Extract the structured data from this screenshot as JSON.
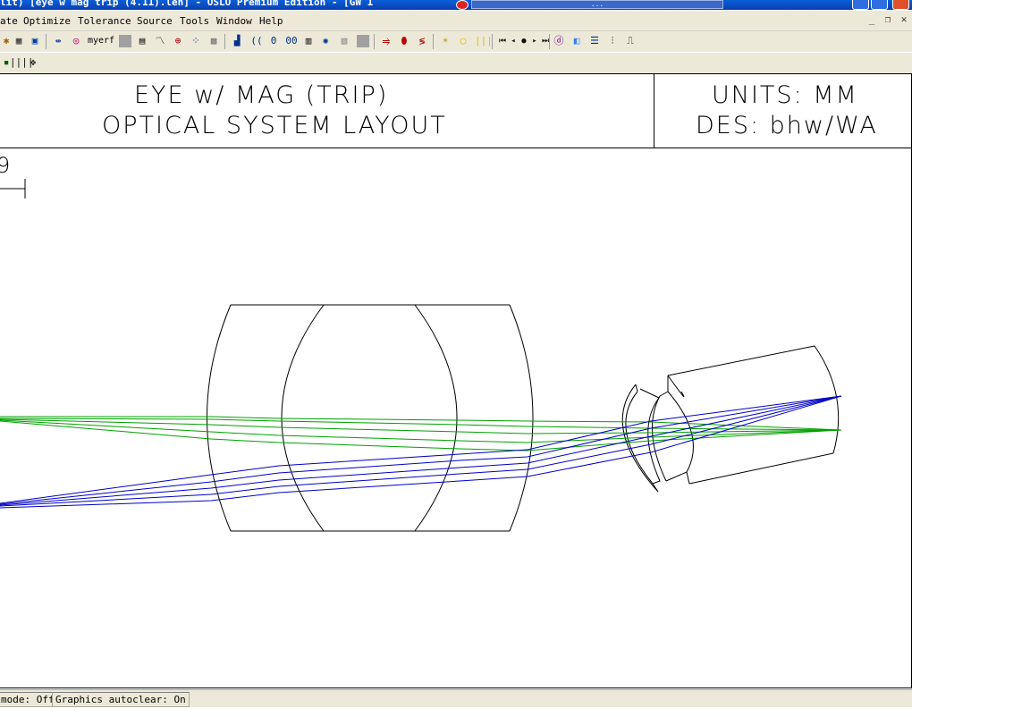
{
  "window": {
    "title": "lit) [eye w mag trip (4.11).len] - OSLO Premium Edition - [GW 1",
    "slot_text": "..."
  },
  "menu": {
    "items": [
      "ate",
      "Optimize",
      "Tolerance",
      "Source",
      "Tools",
      "Window",
      "Help"
    ],
    "mdi": [
      "_",
      "❐",
      "✕"
    ]
  },
  "toolbar": {
    "myerf_label": "myerf"
  },
  "plot": {
    "title_line1": "EYE w/ MAG (TRIP)",
    "title_line2": "OPTICAL SYSTEM LAYOUT",
    "units": "UNITS: MM",
    "designer": "DES: bhw/WA",
    "scale_number": "9"
  },
  "status": {
    "mode": "mode: Off",
    "autoclear": "Graphics autoclear: On"
  },
  "colors": {
    "green_rays": "#00a000",
    "blue_rays": "#0000c8",
    "lens_outline": "#000000"
  }
}
